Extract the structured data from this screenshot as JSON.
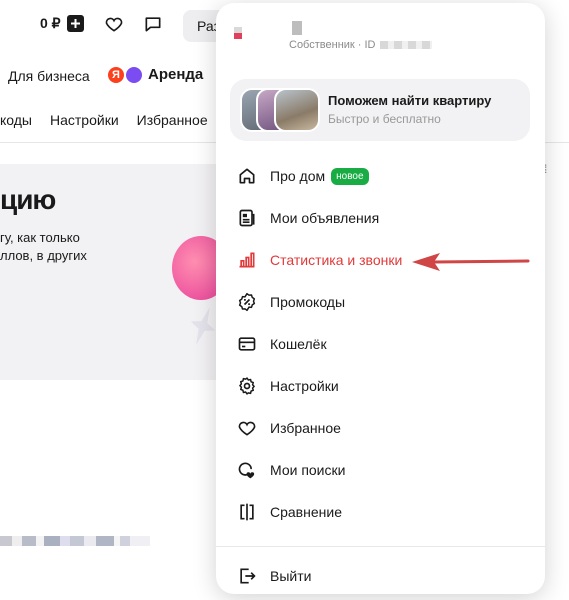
{
  "header": {
    "balance": "0 ₽",
    "place_button": "Раз"
  },
  "subheader": {
    "business": "Для бизнеса",
    "rent": "Аренда",
    "rent_logo_letter": "Я"
  },
  "bg_nav": [
    "коды",
    "Настройки",
    "Избранное"
  ],
  "promo": {
    "title": "цию",
    "text_line1": "гу, как только",
    "text_line2": "ллов, в других"
  },
  "menu": {
    "owner_label": "Собственник · ID",
    "card": {
      "title": "Поможем найти квартиру",
      "subtitle": "Быстро и бесплатно"
    },
    "items": [
      {
        "label": "Про дом",
        "icon": "house-icon",
        "badge": "новое"
      },
      {
        "label": "Мои объявления",
        "icon": "listings-icon"
      },
      {
        "label": "Статистика и звонки",
        "icon": "bar-chart-icon",
        "active": true
      },
      {
        "label": "Промокоды",
        "icon": "percent-badge-icon"
      },
      {
        "label": "Кошелёк",
        "icon": "wallet-card-icon"
      },
      {
        "label": "Настройки",
        "icon": "gear-icon"
      },
      {
        "label": "Избранное",
        "icon": "heart-icon"
      },
      {
        "label": "Мои поиски",
        "icon": "search-heart-icon"
      },
      {
        "label": "Сравнение",
        "icon": "compare-icon"
      }
    ],
    "logout": "Выйти"
  },
  "colors": {
    "accent_red": "#e03a3a",
    "badge_green": "#1aac44",
    "arrow": "#d04545"
  }
}
